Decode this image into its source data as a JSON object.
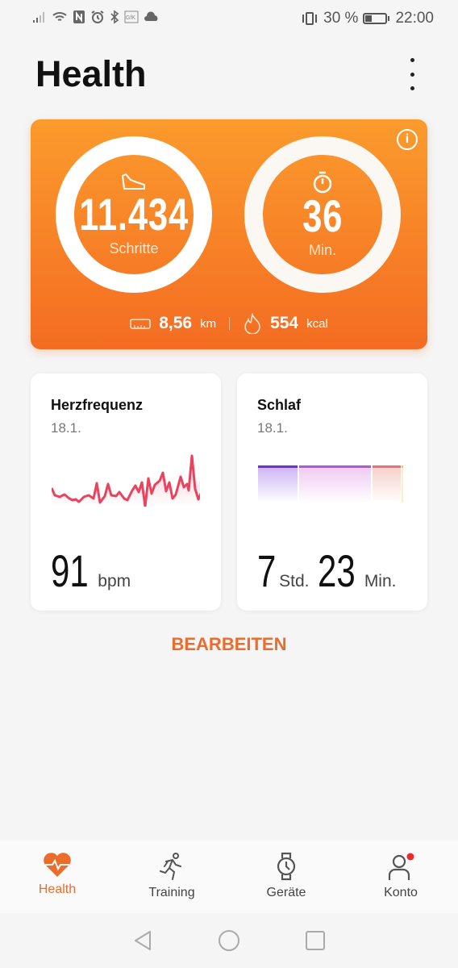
{
  "status_bar": {
    "battery": "30 %",
    "time": "22:00",
    "icons": [
      "signal-icon",
      "wifi-icon",
      "nfc-icon",
      "alarm-icon",
      "bluetooth-icon",
      "gfk-icon",
      "cloud-icon",
      "vibrate-icon",
      "battery-icon"
    ]
  },
  "header": {
    "title": "Health"
  },
  "activity": {
    "steps": "11.434",
    "steps_label": "Schritte",
    "minutes": "36",
    "minutes_label": "Min.",
    "distance": "8,56",
    "distance_unit": "km",
    "calories": "554",
    "calories_unit": "kcal",
    "steps_progress": 0.99,
    "minutes_progress": 0.25,
    "colors": {
      "gradient_top": "#fb9b2d",
      "gradient_bottom": "#f46c22"
    }
  },
  "cards": [
    {
      "title": "Herzfrequenz",
      "date": "18.1.",
      "value": "91",
      "unit": "bpm",
      "color": "#e9435e"
    },
    {
      "title": "Schlaf",
      "date": "18.1.",
      "hours": "7",
      "hours_unit": "Std.",
      "minutes": "23",
      "minutes_unit": "Min."
    }
  ],
  "edit_label": "BEARBEITEN",
  "nav": [
    {
      "label": "Health",
      "icon": "heart-icon",
      "active": true
    },
    {
      "label": "Training",
      "icon": "running-icon"
    },
    {
      "label": "Geräte",
      "icon": "watch-icon"
    },
    {
      "label": "Konto",
      "icon": "person-icon",
      "badge": true
    }
  ],
  "accent": "#ec6c2c"
}
